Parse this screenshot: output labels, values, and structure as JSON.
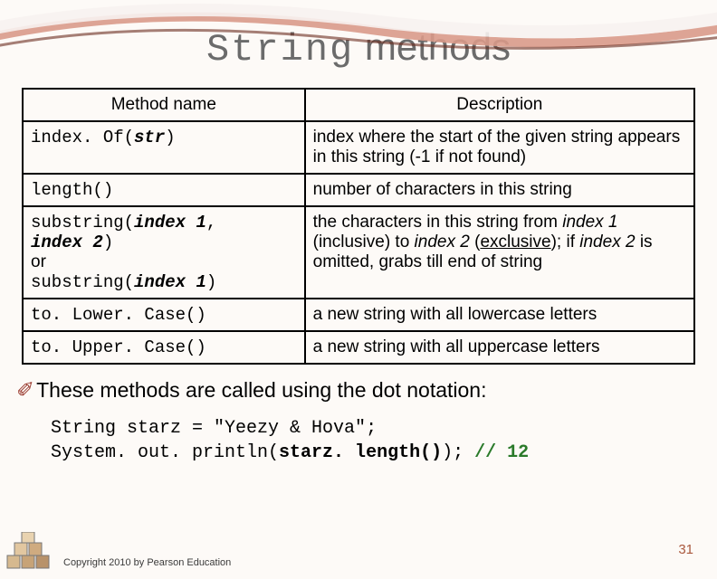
{
  "title": {
    "mono": "String",
    "rest": " methods"
  },
  "table": {
    "headers": [
      "Method name",
      "Description"
    ],
    "rows": [
      {
        "method": {
          "prefix": "index. Of(",
          "bold": "str",
          "suffix": ")"
        },
        "desc": "index where the start of the given string appears in this string (-1 if not found)"
      },
      {
        "method": {
          "prefix": "length()",
          "bold": "",
          "suffix": ""
        },
        "desc": "number of characters in this string"
      },
      {
        "method_html": true,
        "desc_html": true
      },
      {
        "method": {
          "prefix": "to. Lower. Case()",
          "bold": "",
          "suffix": ""
        },
        "desc": "a new string with all lowercase letters"
      },
      {
        "method": {
          "prefix": "to. Upper. Case()",
          "bold": "",
          "suffix": ""
        },
        "desc": "a new string with all uppercase letters"
      }
    ],
    "row3": {
      "m_p1": "substring(",
      "m_b1": "index 1",
      "m_p2": ", ",
      "m_b2": "index 2",
      "m_p3": ")",
      "m_or": "or",
      "m_p4": "substring(",
      "m_b3": "index 1",
      "m_p5": ")",
      "d_pre": "the characters in this string from ",
      "d_i1": "index 1",
      "d_mid1": " (inclusive) to ",
      "d_i2": "index 2",
      "d_mid2": " (",
      "d_u": "exclusive",
      "d_mid3": "); if ",
      "d_i3": "index 2",
      "d_post": " is omitted, grabs till end of string"
    }
  },
  "bullet": "These methods are called using the dot notation:",
  "code": {
    "l1a": "String starz = ",
    "l1b": "\"Yeezy & Hova\"",
    "l1c": ";",
    "l2a": "System. out. println(",
    "l2b": "starz. length()",
    "l2c": ");",
    "l2d": "   ",
    "l2e": "// 12"
  },
  "pagenum": "31",
  "copyright": "Copyright 2010 by Pearson Education"
}
